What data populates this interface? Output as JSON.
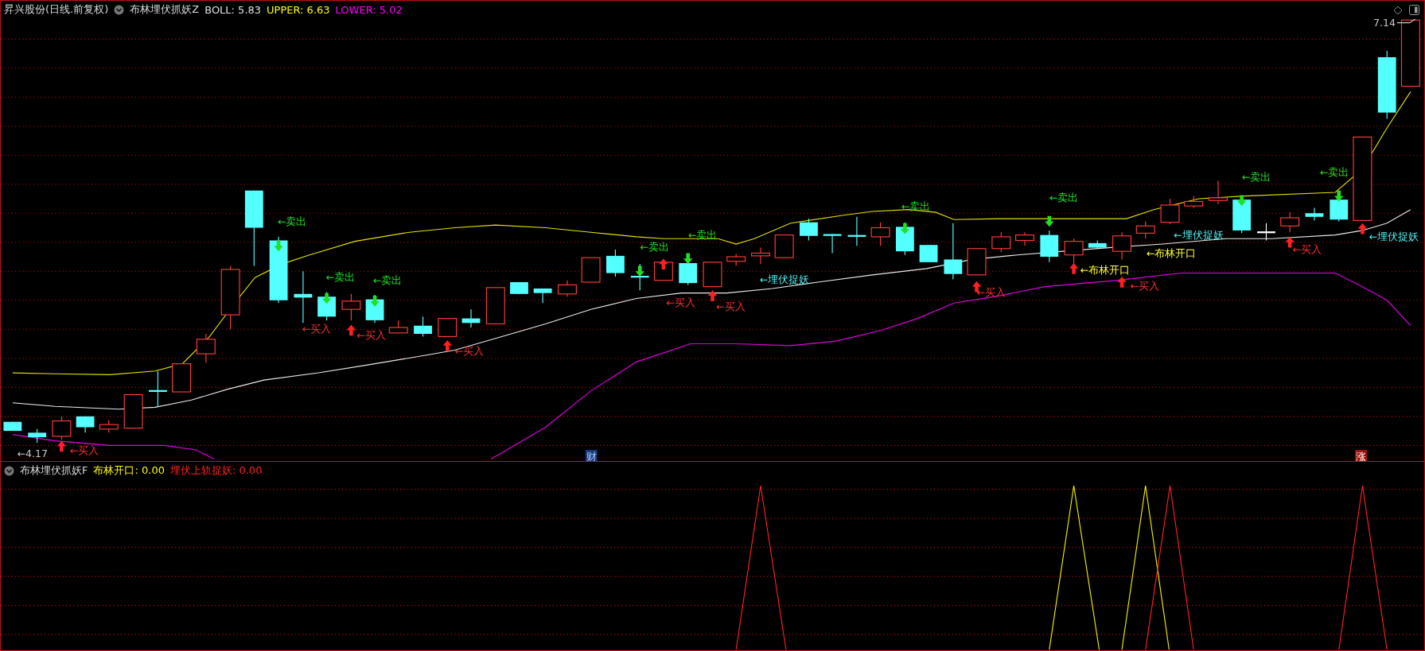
{
  "main_pane": {
    "stock_title": "昇兴股份(日线.前复权)",
    "indicator": "布林埋伏抓妖Z",
    "readings": [
      {
        "text": "BOLL: 5.83",
        "color": "#e0e0e0"
      },
      {
        "text": "UPPER: 6.63",
        "color": "#ffff00"
      },
      {
        "text": "LOWER: 5.02",
        "color": "#ff00ff"
      }
    ],
    "annotations": [
      {
        "kind": "price",
        "text": "←4.17"
      },
      {
        "kind": "buy",
        "text": "←买入"
      },
      {
        "kind": "sell",
        "text": "←卖出"
      },
      {
        "kind": "buy",
        "text": "←买入"
      },
      {
        "kind": "sell",
        "text": "←卖出"
      },
      {
        "kind": "buy",
        "text": "←买入"
      },
      {
        "kind": "sell",
        "text": "←卖出"
      },
      {
        "kind": "buy",
        "text": "←买入"
      },
      {
        "kind": "sell",
        "text": "←卖出"
      },
      {
        "kind": "buy",
        "text": "←买入"
      },
      {
        "kind": "sell",
        "text": "←卖出"
      },
      {
        "kind": "buy",
        "text": "←买入"
      },
      {
        "kind": "bury",
        "text": "←埋伏捉妖"
      },
      {
        "kind": "sell",
        "text": "←卖出"
      },
      {
        "kind": "buy",
        "text": "←买入"
      },
      {
        "kind": "sell",
        "text": "←卖出"
      },
      {
        "kind": "open",
        "text": "←布林开口"
      },
      {
        "kind": "buy",
        "text": "←买入"
      },
      {
        "kind": "open",
        "text": "←布林开口"
      },
      {
        "kind": "bury",
        "text": "←埋伏捉妖"
      },
      {
        "kind": "sell",
        "text": "←卖出"
      },
      {
        "kind": "buy",
        "text": "←买入"
      },
      {
        "kind": "sell",
        "text": "←卖出"
      },
      {
        "kind": "bury",
        "text": "←埋伏捉妖"
      },
      {
        "kind": "price",
        "text": "7.14"
      }
    ],
    "markers": [
      {
        "kind": "finance",
        "text": "财"
      },
      {
        "kind": "limit_up",
        "text": "涨"
      }
    ]
  },
  "sub_pane": {
    "indicator": "布林埋伏抓妖F",
    "readings": [
      {
        "text": "布林开口: 0.00",
        "color": "#ffff00"
      },
      {
        "text": "埋伏上轨捉妖: 0.00",
        "color": "#ff2020"
      }
    ]
  }
}
